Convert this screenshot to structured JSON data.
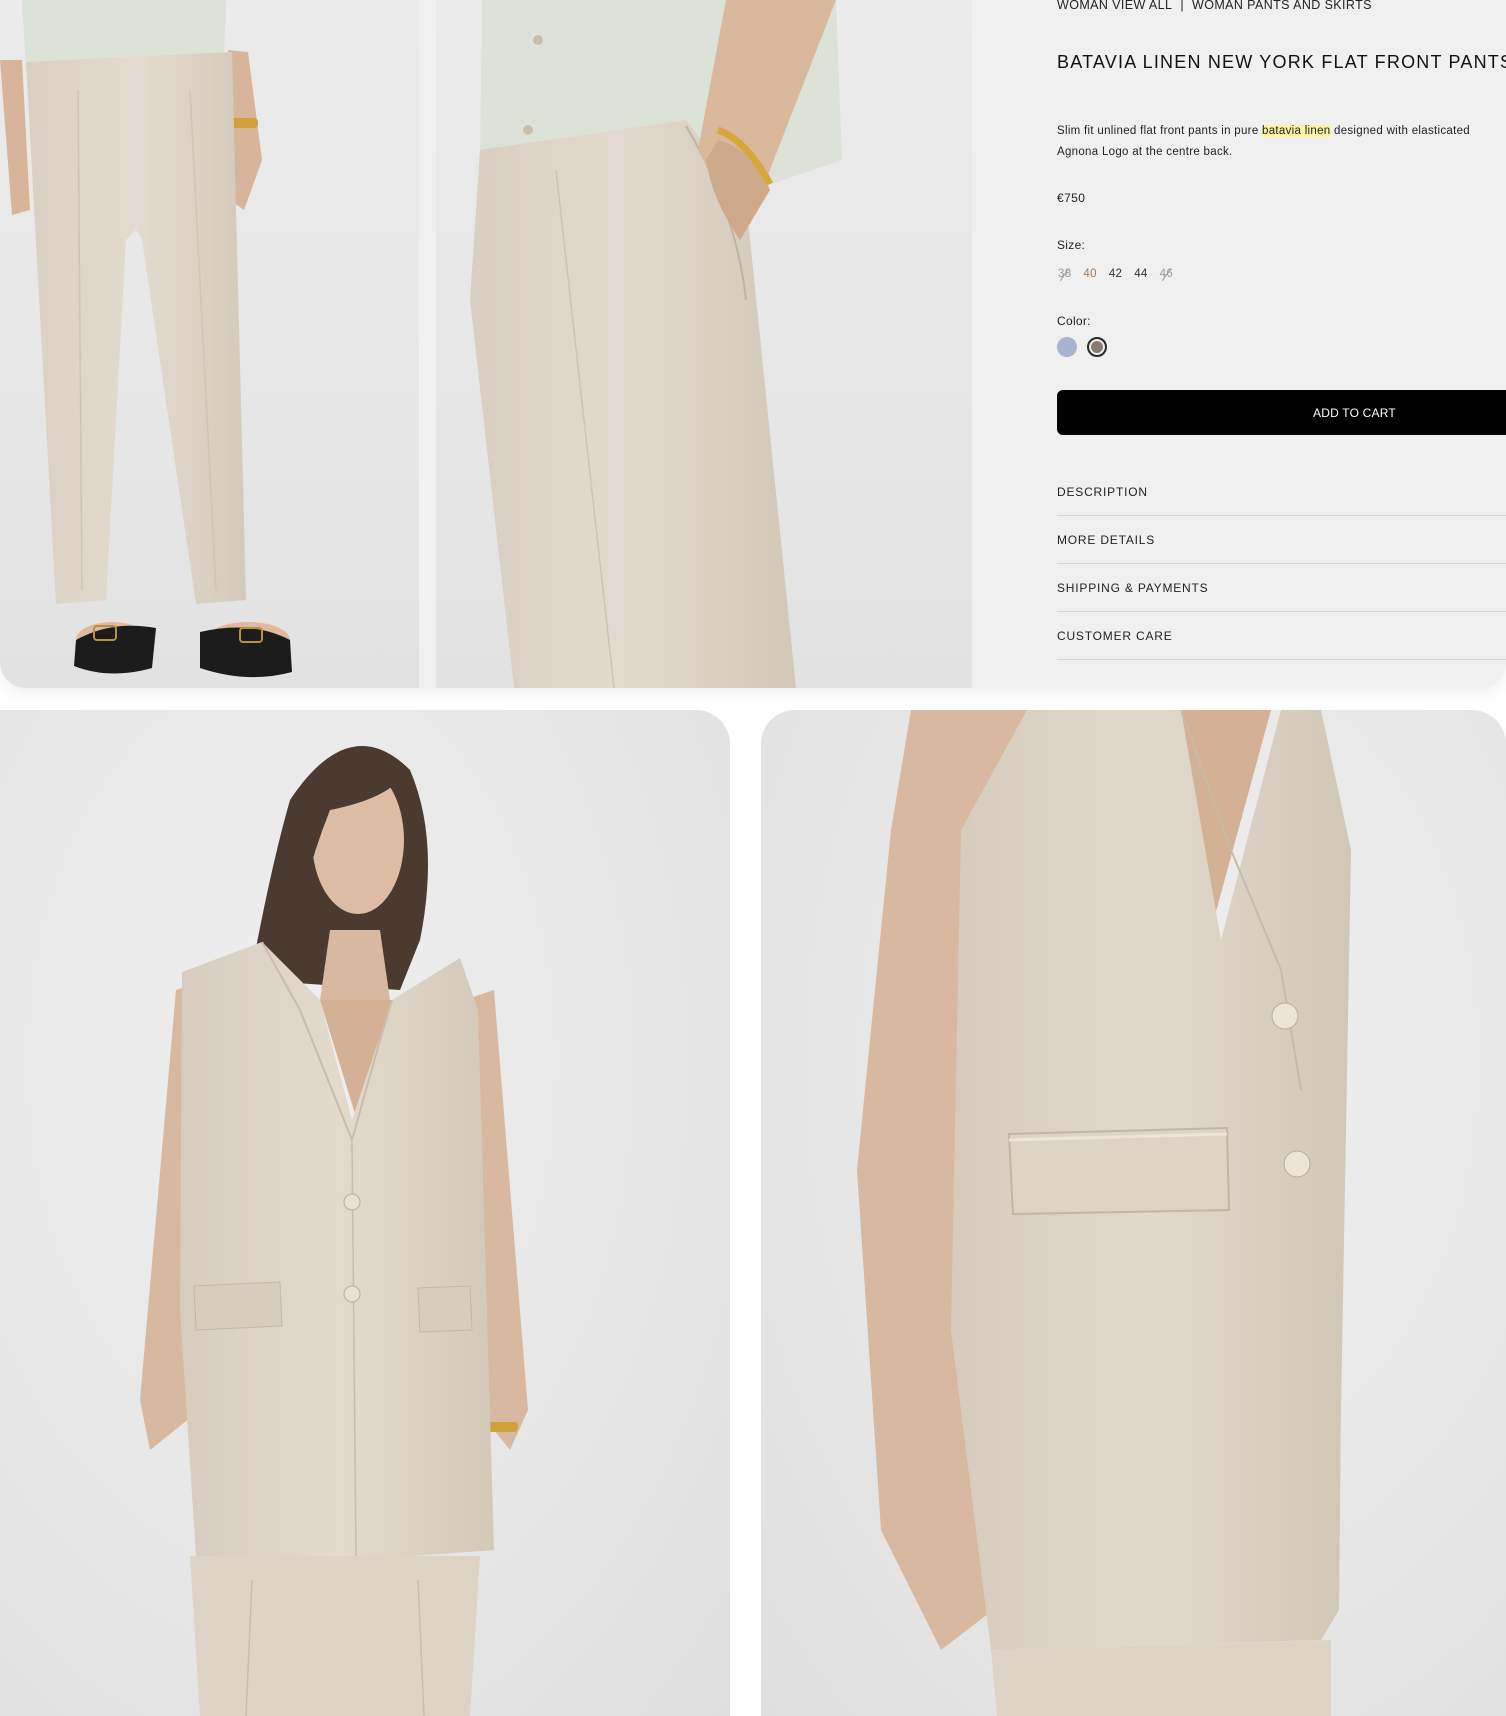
{
  "breadcrumb": {
    "items": [
      "WOMAN VIEW ALL",
      "WOMAN PANTS AND SKIRTS"
    ],
    "separator": "|"
  },
  "product": {
    "title": "BATAVIA LINEN NEW YORK FLAT FRONT PANTS S",
    "description_prefix": "Slim fit unlined flat front pants in pure ",
    "description_highlight": "batavia linen",
    "description_suffix": " designed with elasticated",
    "description_line2": "Agnona Logo at the centre back.",
    "price": "€750"
  },
  "size": {
    "label": "Size:",
    "options": [
      {
        "label": "38",
        "state": "unavailable"
      },
      {
        "label": "40",
        "state": "selected"
      },
      {
        "label": "42",
        "state": "available"
      },
      {
        "label": "44",
        "state": "available"
      },
      {
        "label": "46",
        "state": "unavailable"
      }
    ]
  },
  "color": {
    "label": "Color:",
    "swatches": [
      {
        "name": "light-blue",
        "hex": "#a9b3d1",
        "selected": false
      },
      {
        "name": "taupe",
        "hex": "#8a7a70",
        "selected": true
      }
    ]
  },
  "cart": {
    "button_label": "ADD TO CART"
  },
  "accordion": {
    "items": [
      "DESCRIPTION",
      "MORE DETAILS",
      "SHIPPING & PAYMENTS",
      "CUSTOMER CARE"
    ]
  },
  "colors": {
    "background": "#f0f0f0",
    "button": "#000000",
    "linen": "#ddd4c6",
    "shirt": "#dde2d8",
    "highlight": "#fdf4a0"
  }
}
